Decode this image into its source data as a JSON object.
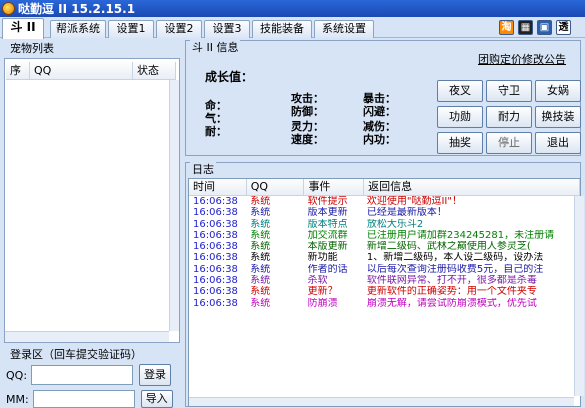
{
  "window": {
    "title": "哒勤逗 II  15.2.15.1"
  },
  "tabs": [
    {
      "label": "斗 II",
      "active": true
    },
    {
      "label": "帮派系统",
      "active": false
    },
    {
      "label": "设置1",
      "active": false
    },
    {
      "label": "设置2",
      "active": false
    },
    {
      "label": "设置3",
      "active": false
    },
    {
      "label": "技能装备",
      "active": false
    },
    {
      "label": "系统设置",
      "active": false
    }
  ],
  "toolbar_icons": [
    "淘",
    "film-icon",
    "image-icon",
    "透"
  ],
  "pet_list": {
    "title": "宠物列表",
    "columns": [
      "序",
      "QQ",
      "状态"
    ]
  },
  "login": {
    "title": "登录区（回车提交验证码）",
    "qq_label": "QQ:",
    "pass_label": "MM:",
    "login_button": "登录",
    "import_button": "导入"
  },
  "info": {
    "title": "斗 II 信息",
    "link": "团购定价修改公告",
    "growth_label": "成长值：",
    "stats": [
      "命：",
      "气：",
      "耐：",
      "攻击：",
      "防御：",
      "灵力：",
      "速度：",
      "暴击：",
      "闪避：",
      "减伤：",
      "内功："
    ],
    "buttons": [
      {
        "label": "夜叉",
        "enabled": true
      },
      {
        "label": "守卫",
        "enabled": true
      },
      {
        "label": "女娲",
        "enabled": true
      },
      {
        "label": "功勋",
        "enabled": true
      },
      {
        "label": "耐力",
        "enabled": true
      },
      {
        "label": "换技装",
        "enabled": true
      },
      {
        "label": "抽奖",
        "enabled": true
      },
      {
        "label": "停止",
        "enabled": false
      },
      {
        "label": "退出",
        "enabled": true
      }
    ]
  },
  "log": {
    "title": "日志",
    "columns": [
      "时间",
      "QQ",
      "事件",
      "返回信息"
    ],
    "rows": [
      {
        "time": "16:06:38",
        "qq": "系统",
        "event": "软件提示",
        "msg": "欢迎使用\"哒勤逗II\"！",
        "time_color": "#2222cc",
        "color": "#cc0000"
      },
      {
        "time": "16:06:38",
        "qq": "系统",
        "event": "版本更新",
        "msg": "已经是最新版本！",
        "time_color": "#2222cc",
        "color": "#1a1aa6"
      },
      {
        "time": "16:06:38",
        "qq": "系统",
        "event": "版本特点",
        "msg": "放松大乐斗2",
        "time_color": "#2222cc",
        "color": "#008080"
      },
      {
        "time": "16:06:38",
        "qq": "系统",
        "event": "加交流群",
        "msg": "已注册用户请加群234245281，未注册请",
        "time_color": "#2222cc",
        "color": "#008000"
      },
      {
        "time": "16:06:38",
        "qq": "系统",
        "event": "本版更新",
        "msg": "新增二级码、武林之巅使用人参灵芝(",
        "time_color": "#2222cc",
        "color": "#006400"
      },
      {
        "time": "16:06:38",
        "qq": "系统",
        "event": "新功能",
        "msg": "1、新增二级码，本人设二级码，设办法",
        "time_color": "#2222cc",
        "color": "#000000"
      },
      {
        "time": "16:06:38",
        "qq": "系统",
        "event": "作者的话",
        "msg": "以后每次查询注册码收费5元，自己的注",
        "time_color": "#2222cc",
        "color": "#1a1aa6"
      },
      {
        "time": "16:06:38",
        "qq": "系统",
        "event": "杀软",
        "msg": "软件联网异常、打不开，很多都是杀毒",
        "time_color": "#2222cc",
        "color": "#7a1aa6"
      },
      {
        "time": "16:06:38",
        "qq": "系统",
        "event": "更新？",
        "msg": "更新软件的正确姿势：用一个文件夹专",
        "time_color": "#2222cc",
        "color": "#cc0000"
      },
      {
        "time": "16:06:38",
        "qq": "系统",
        "event": "防崩溃",
        "msg": "崩溃无解，请尝试防崩溃模式，优先试",
        "time_color": "#2222cc",
        "color": "#c000c0"
      }
    ]
  }
}
